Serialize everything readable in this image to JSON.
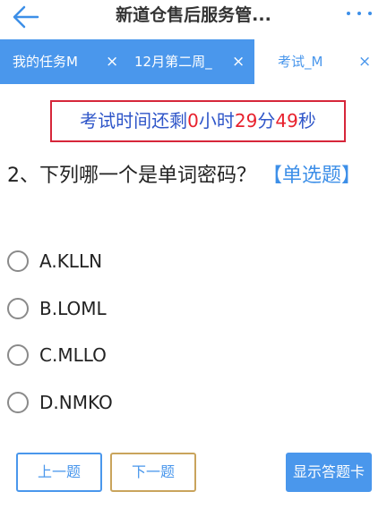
{
  "topbar": {
    "title": "新道仓售后服务管...",
    "back_icon": "arrow-left-icon",
    "more_icon": "more-dots-icon"
  },
  "tabs": [
    {
      "label": "我的任务M",
      "close": "×",
      "active": false
    },
    {
      "label": "12月第二周_",
      "close": "×",
      "active": false
    },
    {
      "label": "考试_M",
      "close": "×",
      "active": true
    }
  ],
  "timer": {
    "prefix": "考试时间还剩",
    "hours": "0",
    "hours_unit": "小时",
    "minutes": "29",
    "minutes_unit": "分",
    "seconds": "49",
    "seconds_unit": "秒"
  },
  "question": {
    "text": "2、下列哪一个是单词密码？",
    "type": "【单选题】"
  },
  "options": [
    {
      "label": "A.KLLN"
    },
    {
      "label": "B.LOML"
    },
    {
      "label": "C.MLLO"
    },
    {
      "label": "D.NMKO"
    }
  ],
  "buttons": {
    "prev": "上一题",
    "next": "下一题",
    "answer_card": "显示答题卡"
  },
  "colors": {
    "accent": "#4a97ec",
    "timer_border": "#d6263a",
    "timer_number": "#e8212d",
    "timer_text": "#2f56c9"
  }
}
